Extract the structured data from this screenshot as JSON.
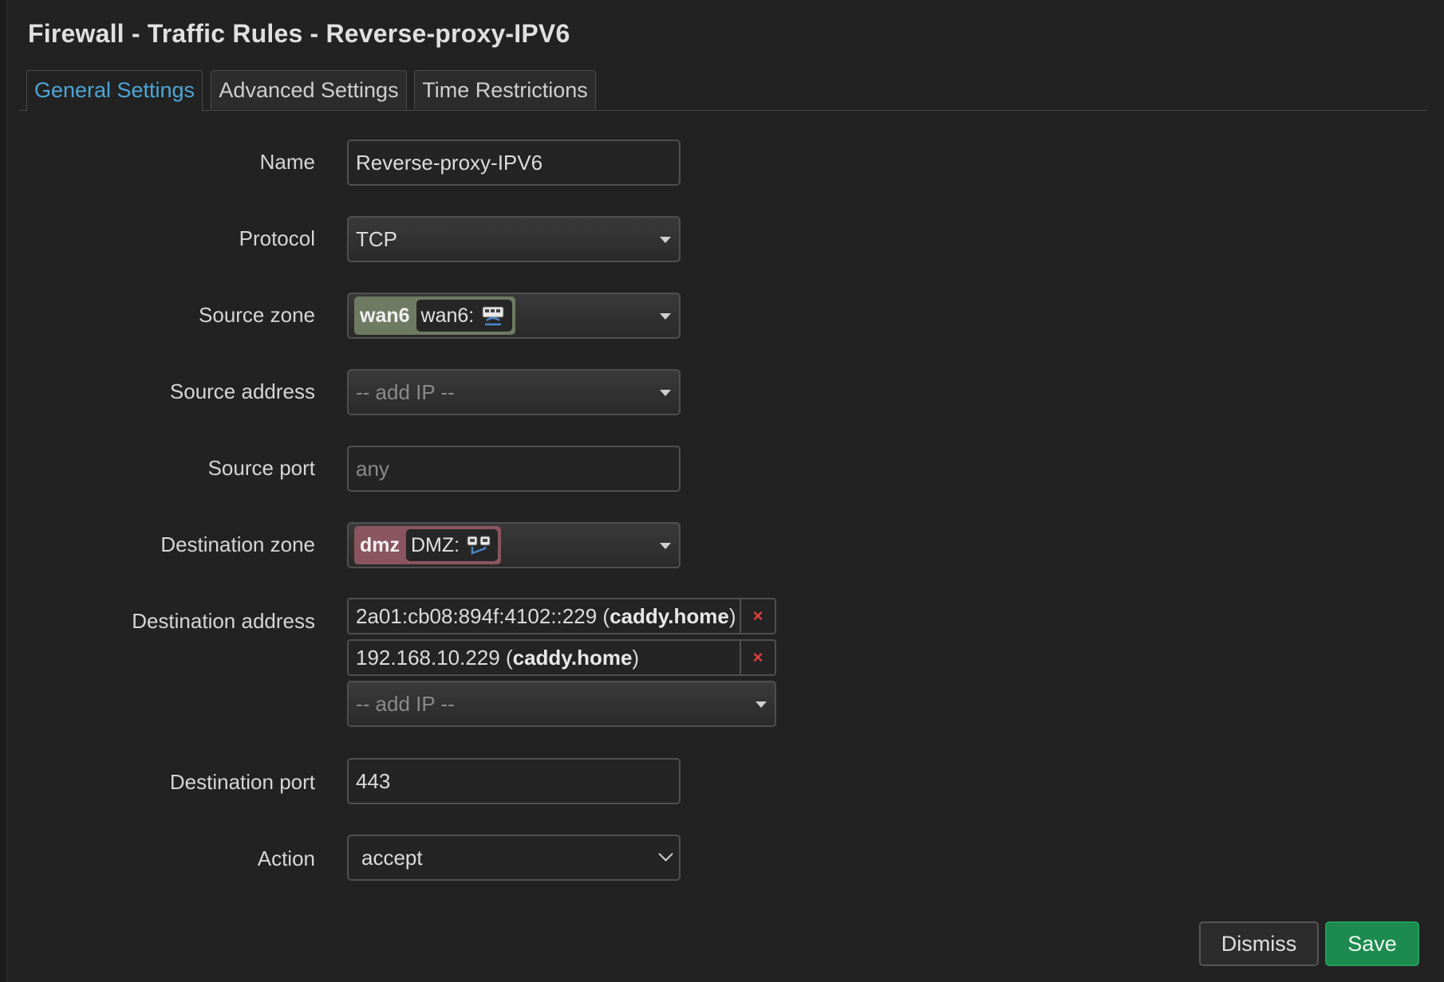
{
  "title": "Firewall - Traffic Rules - Reverse-proxy-IPV6",
  "tabs": [
    {
      "label": "General Settings",
      "active": true
    },
    {
      "label": "Advanced Settings",
      "active": false
    },
    {
      "label": "Time Restrictions",
      "active": false
    }
  ],
  "form": {
    "name": {
      "label": "Name",
      "value": "Reverse-proxy-IPV6"
    },
    "protocol": {
      "label": "Protocol",
      "value": "TCP"
    },
    "source_zone": {
      "label": "Source zone",
      "zone": "wan6",
      "description": "wan6:",
      "color": "#6f7a62"
    },
    "source_address": {
      "label": "Source address",
      "placeholder": "-- add IP --"
    },
    "source_port": {
      "label": "Source port",
      "placeholder": "any"
    },
    "destination_zone": {
      "label": "Destination zone",
      "zone": "dmz",
      "description": "DMZ:",
      "color": "#8a5560"
    },
    "destination_address": {
      "label": "Destination address",
      "entries": [
        {
          "address": "2a01:cb08:894f:4102::229",
          "host": "caddy.home"
        },
        {
          "address": "192.168.10.229",
          "host": "caddy.home"
        }
      ],
      "placeholder": "-- add IP --",
      "remove_glyph": "×"
    },
    "destination_port": {
      "label": "Destination port",
      "value": "443"
    },
    "action": {
      "label": "Action",
      "value": "accept"
    }
  },
  "buttons": {
    "dismiss": "Dismiss",
    "save": "Save"
  },
  "icons": {
    "zone_icon": "network-interface-icon",
    "dropdown_icon": "caret-down-icon",
    "remove_icon": "close-icon"
  },
  "colors": {
    "accent": "#4da6d6",
    "save": "#1d8a4f",
    "remove": "#e04040"
  }
}
